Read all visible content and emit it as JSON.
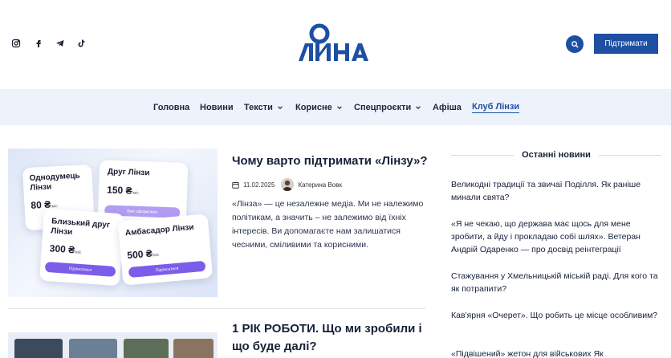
{
  "header": {
    "logo_text": "ЛІНЗА",
    "support_button": "Підтримати",
    "social_icons": [
      "instagram-icon",
      "facebook-icon",
      "telegram-icon",
      "tiktok-icon"
    ],
    "accent_color": "#1d4fa3"
  },
  "nav": {
    "items": [
      {
        "label": "Головна",
        "has_dropdown": false
      },
      {
        "label": "Новини",
        "has_dropdown": false
      },
      {
        "label": "Тексти",
        "has_dropdown": true
      },
      {
        "label": "Корисне",
        "has_dropdown": true
      },
      {
        "label": "Спецпроєкти",
        "has_dropdown": true
      },
      {
        "label": "Афіша",
        "has_dropdown": false
      },
      {
        "label": "Клуб Лінзи",
        "has_dropdown": false,
        "active": true
      }
    ]
  },
  "articles": [
    {
      "title": "Чому варто підтримати «Лінзу»?",
      "date": "11.02.2025",
      "author": "Катерина Вовк",
      "excerpt": "«Лінза» — це незалежне медіа. Ми не належимо політикам, а значить – не залежимо від їхніх інтересів. Ви допомагаєте нам залишатися чесними, сміливими та корисними.",
      "image": {
        "cards": [
          {
            "title": "Однодумець Лінзи",
            "price": "80 ₴",
            "period": "/міс"
          },
          {
            "title": "Друг Лінзи",
            "price": "150 ₴",
            "period": "/міс",
            "button": "Вже оформлено"
          },
          {
            "title": "Близький друг Лінзи",
            "price": "300 ₴",
            "period": "/міс",
            "button": "Підписатися"
          },
          {
            "title": "Амбасадор Лінзи",
            "price": "500 ₴",
            "period": "/міс",
            "button": "Підписатися"
          }
        ]
      }
    },
    {
      "title": "1 РІК РОБОТИ. Що ми зробили і що буде далі?"
    }
  ],
  "sidebar": {
    "heading": "Останні новини",
    "news": [
      "Великодні традиції та звичаї Поділля. Як раніше минали свята?",
      "«Я не чекаю, що держава має щось для мене зробити, а йду і прокладаю собі шлях». Ветеран Андрій Одаренко — про досвід реінтеграції",
      "Стажування у Хмельницькій міській раді. Для кого та як потрапити?",
      "Кав'ярня «Очерет». Що робить це місце особливим?",
      "«Підвішений» жетон для військових Як"
    ]
  }
}
